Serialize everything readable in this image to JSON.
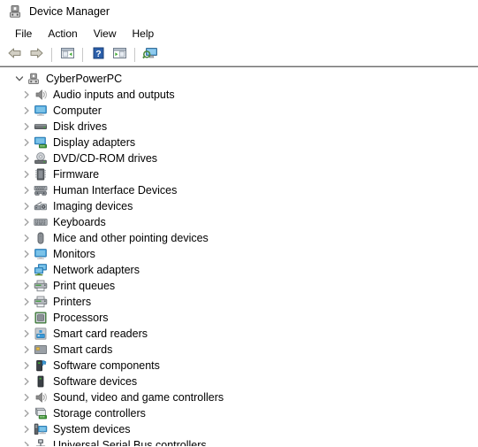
{
  "window": {
    "title": "Device Manager",
    "icon": "device-manager-icon"
  },
  "menubar": {
    "items": [
      {
        "label": "File"
      },
      {
        "label": "Action"
      },
      {
        "label": "View"
      },
      {
        "label": "Help"
      }
    ]
  },
  "toolbar": {
    "items": [
      {
        "name": "back-button",
        "icon": "back-arrow-icon",
        "type": "button"
      },
      {
        "name": "forward-button",
        "icon": "forward-arrow-icon",
        "type": "button"
      },
      {
        "name": "separator-1",
        "icon": "separator",
        "type": "separator"
      },
      {
        "name": "show-hide-console-tree-button",
        "icon": "console-tree-icon",
        "type": "button"
      },
      {
        "name": "separator-2",
        "icon": "separator",
        "type": "separator"
      },
      {
        "name": "help-button",
        "icon": "help-question-icon",
        "type": "button"
      },
      {
        "name": "properties-button",
        "icon": "properties-window-icon",
        "type": "button"
      },
      {
        "name": "separator-3",
        "icon": "separator",
        "type": "separator"
      },
      {
        "name": "scan-for-hardware-changes-button",
        "icon": "scan-hardware-icon",
        "type": "button"
      }
    ]
  },
  "tree": {
    "root": {
      "label": "CyberPowerPC",
      "icon": "computer-chip-icon",
      "expanded": true,
      "twisty": "chevron-down-icon"
    },
    "nodes": [
      {
        "label": "Audio inputs and outputs",
        "icon": "speaker-icon"
      },
      {
        "label": "Computer",
        "icon": "monitor-icon"
      },
      {
        "label": "Disk drives",
        "icon": "disk-drive-icon"
      },
      {
        "label": "Display adapters",
        "icon": "display-adapter-icon"
      },
      {
        "label": "DVD/CD-ROM drives",
        "icon": "optical-drive-icon"
      },
      {
        "label": "Firmware",
        "icon": "chip-icon"
      },
      {
        "label": "Human Interface Devices",
        "icon": "hid-keyboard-icon"
      },
      {
        "label": "Imaging devices",
        "icon": "imaging-device-icon"
      },
      {
        "label": "Keyboards",
        "icon": "keyboard-icon"
      },
      {
        "label": "Mice and other pointing devices",
        "icon": "mouse-icon"
      },
      {
        "label": "Monitors",
        "icon": "monitor-icon"
      },
      {
        "label": "Network adapters",
        "icon": "network-adapter-icon"
      },
      {
        "label": "Print queues",
        "icon": "printer-icon"
      },
      {
        "label": "Printers",
        "icon": "printer-icon"
      },
      {
        "label": "Processors",
        "icon": "processor-icon"
      },
      {
        "label": "Smart card readers",
        "icon": "smart-card-reader-icon"
      },
      {
        "label": "Smart cards",
        "icon": "smart-card-icon"
      },
      {
        "label": "Software components",
        "icon": "software-component-icon"
      },
      {
        "label": "Software devices",
        "icon": "software-device-icon"
      },
      {
        "label": "Sound, video and game controllers",
        "icon": "speaker-icon"
      },
      {
        "label": "Storage controllers",
        "icon": "storage-controller-icon"
      },
      {
        "label": "System devices",
        "icon": "system-device-icon"
      },
      {
        "label": "Universal Serial Bus controllers",
        "icon": "usb-controller-icon"
      }
    ],
    "collapsed_twisty": "chevron-right-icon"
  },
  "colors": {
    "accent_blue": "#3a9ad9",
    "icon_gray": "#808080",
    "led_green": "#3faa33",
    "toolbar_border": "#bfbfbf",
    "content_border": "#6f6f6f",
    "text": "#000000",
    "twisty": "#a0a0a0"
  }
}
